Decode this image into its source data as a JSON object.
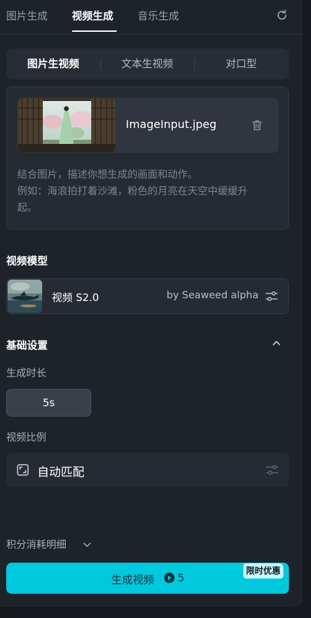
{
  "top_tabs": [
    {
      "label": "图片生成"
    },
    {
      "label": "视频生成"
    },
    {
      "label": "音乐生成"
    }
  ],
  "active_top_tab": "视频生成",
  "mode_tabs": [
    {
      "label": "图片生视频"
    },
    {
      "label": "文本生视频"
    },
    {
      "label": "对口型"
    }
  ],
  "active_mode_tab": "图片生视频",
  "upload": {
    "file_name": "ImageInput.jpeg"
  },
  "prompt": {
    "placeholder_line1": "结合图片，描述你想生成的画面和动作。",
    "placeholder_line2": "例如：海浪拍打着沙滩，粉色的月亮在天空中缓缓升",
    "placeholder_line3": "起。"
  },
  "model_section": {
    "title": "视频模型",
    "model_name": "视频 S2.0",
    "model_by": "by Seaweed alpha"
  },
  "basic_settings": {
    "title": "基础设置",
    "duration_label": "生成时长",
    "duration_value": "5s",
    "ratio_label": "视频比例",
    "ratio_value": "自动匹配"
  },
  "cost_details": {
    "label": "积分消耗明细"
  },
  "generate_button": {
    "label": "生成视频",
    "cost": "5",
    "promo_badge": "限时优惠"
  },
  "colors": {
    "accent": "#00c8dd",
    "panel_bg": "#1e2229",
    "page_bg": "#16191f"
  },
  "icons": [
    "refresh-icon",
    "trash-icon",
    "settings-sliders-icon",
    "chevron-up-icon",
    "aspect-ratio-icon",
    "chevron-down-icon",
    "credit-icon"
  ]
}
